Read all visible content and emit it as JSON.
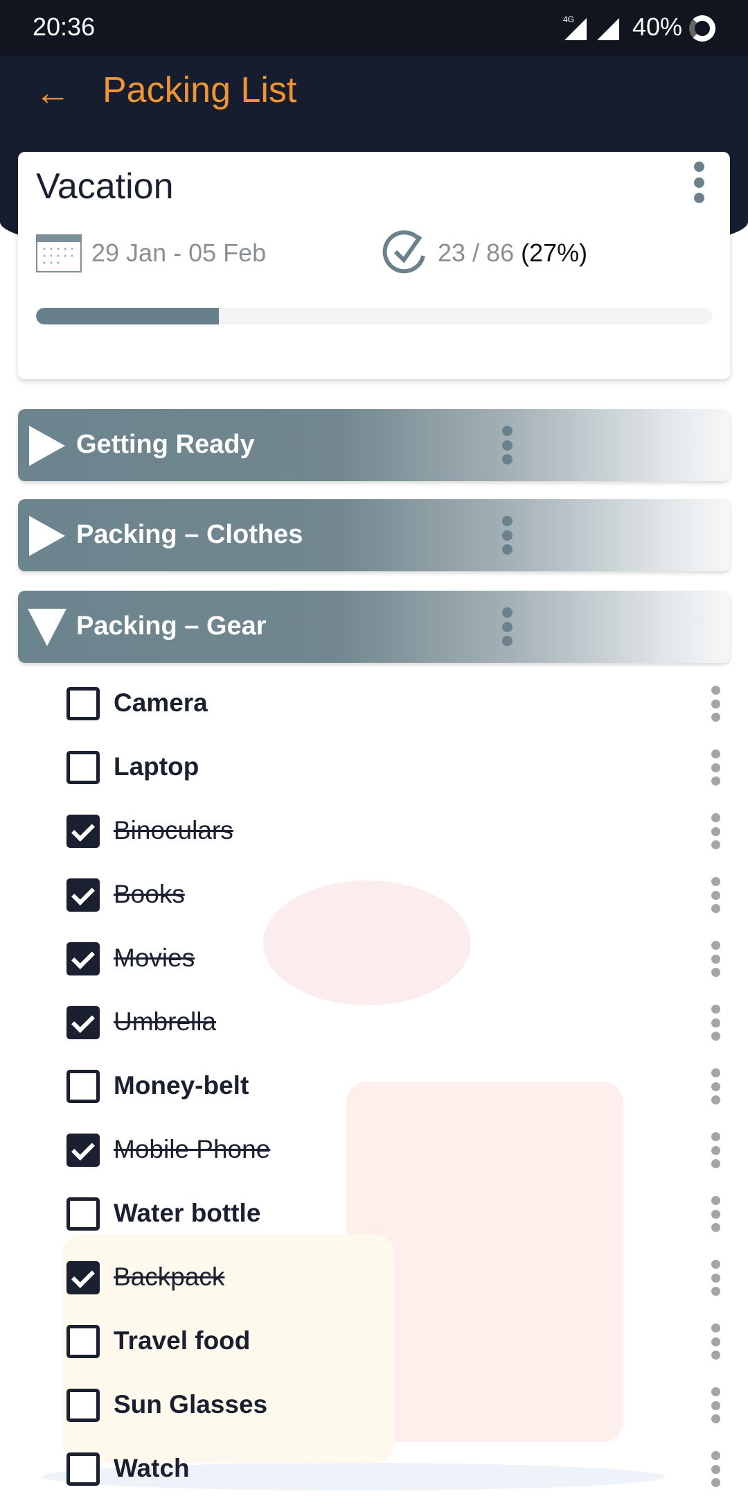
{
  "status_bar": {
    "time": "20:36",
    "network": "4G",
    "battery": "40%"
  },
  "header": {
    "title": "Packing List",
    "back_icon": "arrow-left-icon"
  },
  "trip": {
    "name": "Vacation",
    "dates": "29 Jan - 05 Feb",
    "progress_count": "23 / 86",
    "progress_percent": "(27%)",
    "progress_value": 27
  },
  "colors": {
    "accent": "#f0952f",
    "header_bg": "#161d2e",
    "group_bg": "#6b848e"
  },
  "groups": [
    {
      "label": "Getting Ready",
      "expanded": false
    },
    {
      "label": "Packing – Clothes",
      "expanded": false
    },
    {
      "label": "Packing – Gear",
      "expanded": true
    }
  ],
  "items": [
    {
      "label": "Camera",
      "checked": false
    },
    {
      "label": "Laptop",
      "checked": false
    },
    {
      "label": "Binoculars",
      "checked": true
    },
    {
      "label": "Books",
      "checked": true
    },
    {
      "label": "Movies",
      "checked": true
    },
    {
      "label": "Umbrella",
      "checked": true
    },
    {
      "label": "Money-belt",
      "checked": false
    },
    {
      "label": "Mobile Phone",
      "checked": true
    },
    {
      "label": "Water bottle",
      "checked": false
    },
    {
      "label": "Backpack",
      "checked": true
    },
    {
      "label": "Travel food",
      "checked": false
    },
    {
      "label": "Sun Glasses",
      "checked": false
    },
    {
      "label": "Watch",
      "checked": false
    }
  ]
}
